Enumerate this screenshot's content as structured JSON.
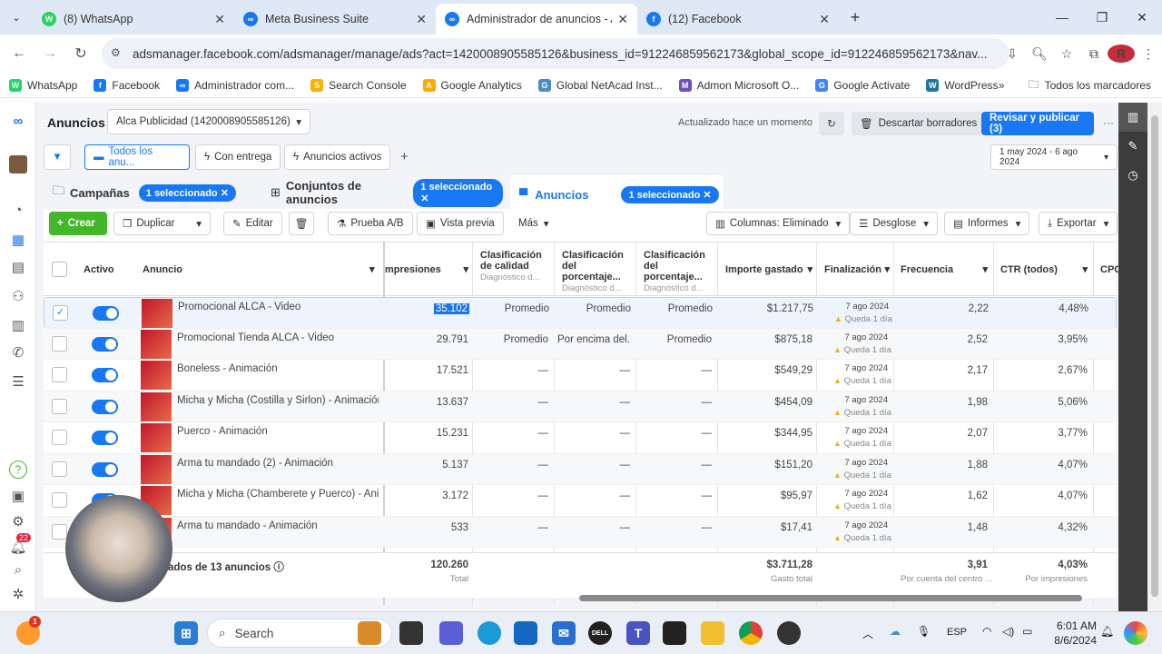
{
  "browser": {
    "tabs": [
      {
        "title": "(8) WhatsApp",
        "color": "#25d366",
        "glyph": "W"
      },
      {
        "title": "Meta Business Suite",
        "color": "#1877f2",
        "glyph": "∞"
      },
      {
        "title": "Administrador de anuncios - Ad",
        "color": "#1877f2",
        "glyph": "∞"
      },
      {
        "title": "(12) Facebook",
        "color": "#1877f2",
        "glyph": "f"
      }
    ],
    "url": "adsmanager.facebook.com/adsmanager/manage/ads?act=1420008905585126&business_id=912246859562173&global_scope_id=912246859562173&nav...",
    "profile": "R",
    "bookmarks": [
      {
        "label": "WhatsApp",
        "color": "#25d366",
        "glyph": "W"
      },
      {
        "label": "Facebook",
        "color": "#1877f2",
        "glyph": "f"
      },
      {
        "label": "Administrador com...",
        "color": "#1877f2",
        "glyph": "∞"
      },
      {
        "label": "Search Console",
        "color": "#f4b400",
        "glyph": "S"
      },
      {
        "label": "Google Analytics",
        "color": "#f9ab00",
        "glyph": "A"
      },
      {
        "label": "Global NetAcad Inst...",
        "color": "#4a8bc4",
        "glyph": "G"
      },
      {
        "label": "Admon Microsoft O...",
        "color": "#6b4fbb",
        "glyph": "M"
      },
      {
        "label": "Google Activate",
        "color": "#4285f4",
        "glyph": "G"
      },
      {
        "label": "WordPress",
        "color": "#21759b",
        "glyph": "W"
      }
    ],
    "all_bookmarks": "Todos los marcadores"
  },
  "header": {
    "section": "Anuncios",
    "account": "Alca Publicidad (1420008905585126)",
    "updated": "Actualizado hace un momento",
    "discard": "Descartar borradores",
    "publish": "Revisar y publicar (3)",
    "date_range": "1 may 2024 - 6 ago 2024"
  },
  "filters": {
    "all": "Todos los anu...",
    "delivery": "Con entrega",
    "active": "Anuncios activos"
  },
  "levels": {
    "campaigns": "Campañas",
    "campaigns_sel": "1 seleccionado",
    "adsets": "Conjuntos de anuncios",
    "adsets_sel": "1 seleccionado",
    "ads": "Anuncios",
    "ads_sel": "1 seleccionado"
  },
  "toolbar": {
    "create": "Crear",
    "duplicate": "Duplicar",
    "edit": "Editar",
    "abtest": "Prueba A/B",
    "preview": "Vista previa",
    "more": "Más",
    "columns": "Columnas: Eliminado",
    "breakdown": "Desglose",
    "reports": "Informes",
    "export": "Exportar"
  },
  "columns": {
    "active": "Activo",
    "ad": "Anuncio",
    "impressions": "mpresiones",
    "quality": "Clasificación de calidad",
    "quality_sub": "Diagnóstico d...",
    "engagement": "Clasificación del porcentaje...",
    "engagement_sub": "Diagnóstico d...",
    "conversion": "Clasificación del porcentaje...",
    "conversion_sub": "Diagnóstico d...",
    "spent": "Importe gastado",
    "end": "Finalización",
    "frequency": "Frecuencia",
    "ctr": "CTR (todos)",
    "cpc": "CPC"
  },
  "rows": [
    {
      "name": "Promocional ALCA - Video",
      "impr": "35.102",
      "q": "Promedio",
      "e": "Promedio",
      "c": "Promedio",
      "spent": "$1.217,75",
      "end": "7 ago 2024",
      "left": "Queda 1 día",
      "freq": "2,22",
      "ctr": "4,48%"
    },
    {
      "name": "Promocional Tienda ALCA - Video",
      "impr": "29.791",
      "q": "Promedio",
      "e": "Por encima del...",
      "c": "Promedio",
      "spent": "$875,18",
      "end": "7 ago 2024",
      "left": "Queda 1 día",
      "freq": "2,52",
      "ctr": "3,95%"
    },
    {
      "name": "Boneless - Animación",
      "impr": "17.521",
      "q": "—",
      "e": "—",
      "c": "—",
      "spent": "$549,29",
      "end": "7 ago 2024",
      "left": "Queda 1 día",
      "freq": "2,17",
      "ctr": "2,67%"
    },
    {
      "name": "Micha y Micha (Costilla y Sirlon) - Animación",
      "impr": "13.637",
      "q": "—",
      "e": "—",
      "c": "—",
      "spent": "$454,09",
      "end": "7 ago 2024",
      "left": "Queda 1 día",
      "freq": "1,98",
      "ctr": "5,06%"
    },
    {
      "name": "Puerco - Animación",
      "impr": "15.231",
      "q": "—",
      "e": "—",
      "c": "—",
      "spent": "$344,95",
      "end": "7 ago 2024",
      "left": "Queda 1 día",
      "freq": "2,07",
      "ctr": "3,77%"
    },
    {
      "name": "Arma tu mandado (2) - Animación",
      "impr": "5.137",
      "q": "—",
      "e": "—",
      "c": "—",
      "spent": "$151,20",
      "end": "7 ago 2024",
      "left": "Queda 1 día",
      "freq": "1,88",
      "ctr": "4,07%"
    },
    {
      "name": "Micha y Micha (Chamberete y Puerco) - Anim...",
      "impr": "3.172",
      "q": "—",
      "e": "—",
      "c": "—",
      "spent": "$95,97",
      "end": "7 ago 2024",
      "left": "Queda 1 día",
      "freq": "1,62",
      "ctr": "4,07%"
    },
    {
      "name": "Arma tu mandado - Animación",
      "impr": "533",
      "q": "—",
      "e": "—",
      "c": "—",
      "spent": "$17,41",
      "end": "7 ago 2024",
      "left": "Queda 1 día",
      "freq": "1,48",
      "ctr": "4,32%"
    }
  ],
  "totals": {
    "label": "ados de 13 anuncios",
    "impr": "120.260",
    "impr_sub": "Total",
    "spent": "$3.711,28",
    "spent_sub": "Gasto total",
    "freq": "3,91",
    "freq_sub": "Por cuenta del centro ...",
    "ctr": "4,03%",
    "ctr_sub": "Por impresiones"
  },
  "rail_badge": "22",
  "taskbar": {
    "search": "Search",
    "lang": "ESP",
    "time": "6:01 AM",
    "date": "8/6/2024",
    "badge": "1"
  }
}
